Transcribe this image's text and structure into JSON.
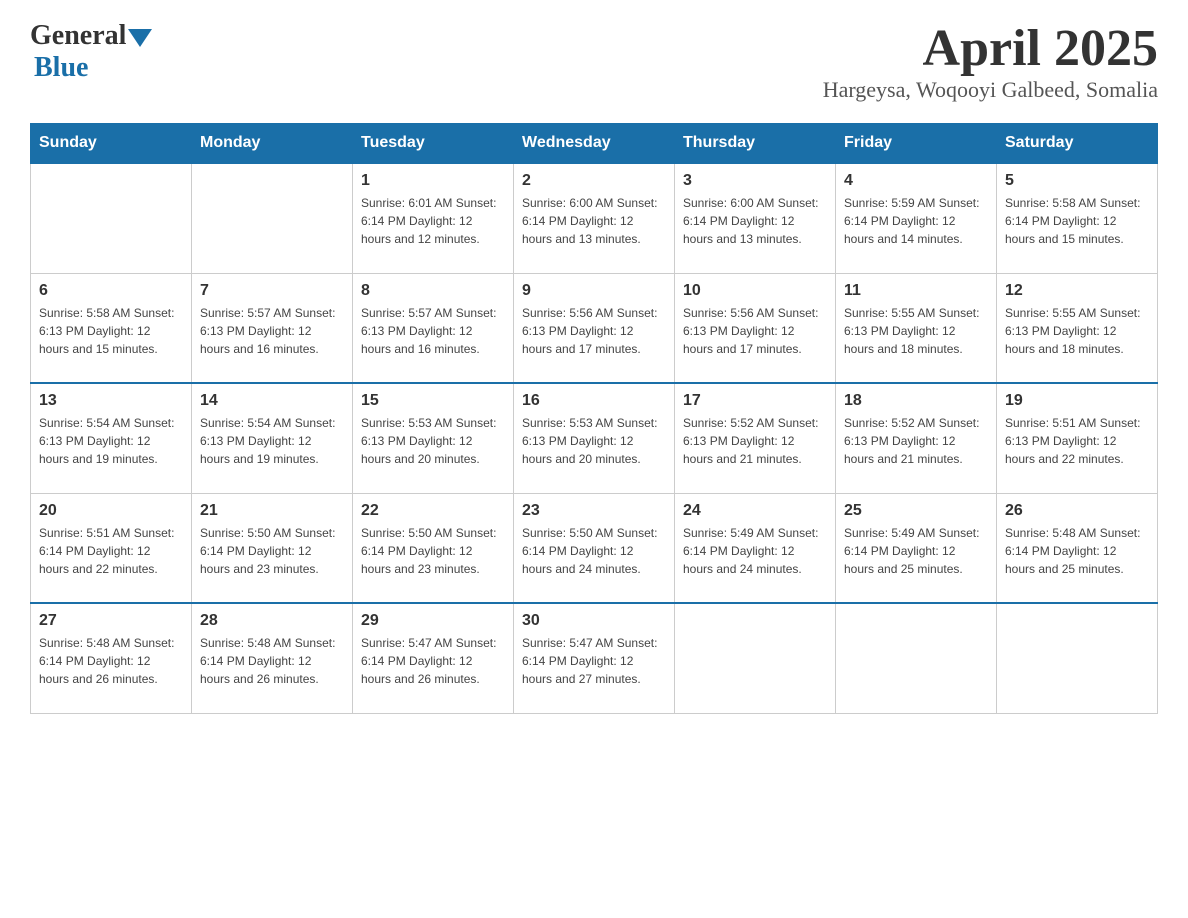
{
  "header": {
    "logo": {
      "general": "General",
      "blue": "Blue"
    },
    "title": "April 2025",
    "location": "Hargeysa, Woqooyi Galbeed, Somalia"
  },
  "days_of_week": [
    "Sunday",
    "Monday",
    "Tuesday",
    "Wednesday",
    "Thursday",
    "Friday",
    "Saturday"
  ],
  "weeks": [
    [
      {
        "day": "",
        "info": ""
      },
      {
        "day": "",
        "info": ""
      },
      {
        "day": "1",
        "info": "Sunrise: 6:01 AM\nSunset: 6:14 PM\nDaylight: 12 hours\nand 12 minutes."
      },
      {
        "day": "2",
        "info": "Sunrise: 6:00 AM\nSunset: 6:14 PM\nDaylight: 12 hours\nand 13 minutes."
      },
      {
        "day": "3",
        "info": "Sunrise: 6:00 AM\nSunset: 6:14 PM\nDaylight: 12 hours\nand 13 minutes."
      },
      {
        "day": "4",
        "info": "Sunrise: 5:59 AM\nSunset: 6:14 PM\nDaylight: 12 hours\nand 14 minutes."
      },
      {
        "day": "5",
        "info": "Sunrise: 5:58 AM\nSunset: 6:14 PM\nDaylight: 12 hours\nand 15 minutes."
      }
    ],
    [
      {
        "day": "6",
        "info": "Sunrise: 5:58 AM\nSunset: 6:13 PM\nDaylight: 12 hours\nand 15 minutes."
      },
      {
        "day": "7",
        "info": "Sunrise: 5:57 AM\nSunset: 6:13 PM\nDaylight: 12 hours\nand 16 minutes."
      },
      {
        "day": "8",
        "info": "Sunrise: 5:57 AM\nSunset: 6:13 PM\nDaylight: 12 hours\nand 16 minutes."
      },
      {
        "day": "9",
        "info": "Sunrise: 5:56 AM\nSunset: 6:13 PM\nDaylight: 12 hours\nand 17 minutes."
      },
      {
        "day": "10",
        "info": "Sunrise: 5:56 AM\nSunset: 6:13 PM\nDaylight: 12 hours\nand 17 minutes."
      },
      {
        "day": "11",
        "info": "Sunrise: 5:55 AM\nSunset: 6:13 PM\nDaylight: 12 hours\nand 18 minutes."
      },
      {
        "day": "12",
        "info": "Sunrise: 5:55 AM\nSunset: 6:13 PM\nDaylight: 12 hours\nand 18 minutes."
      }
    ],
    [
      {
        "day": "13",
        "info": "Sunrise: 5:54 AM\nSunset: 6:13 PM\nDaylight: 12 hours\nand 19 minutes."
      },
      {
        "day": "14",
        "info": "Sunrise: 5:54 AM\nSunset: 6:13 PM\nDaylight: 12 hours\nand 19 minutes."
      },
      {
        "day": "15",
        "info": "Sunrise: 5:53 AM\nSunset: 6:13 PM\nDaylight: 12 hours\nand 20 minutes."
      },
      {
        "day": "16",
        "info": "Sunrise: 5:53 AM\nSunset: 6:13 PM\nDaylight: 12 hours\nand 20 minutes."
      },
      {
        "day": "17",
        "info": "Sunrise: 5:52 AM\nSunset: 6:13 PM\nDaylight: 12 hours\nand 21 minutes."
      },
      {
        "day": "18",
        "info": "Sunrise: 5:52 AM\nSunset: 6:13 PM\nDaylight: 12 hours\nand 21 minutes."
      },
      {
        "day": "19",
        "info": "Sunrise: 5:51 AM\nSunset: 6:13 PM\nDaylight: 12 hours\nand 22 minutes."
      }
    ],
    [
      {
        "day": "20",
        "info": "Sunrise: 5:51 AM\nSunset: 6:14 PM\nDaylight: 12 hours\nand 22 minutes."
      },
      {
        "day": "21",
        "info": "Sunrise: 5:50 AM\nSunset: 6:14 PM\nDaylight: 12 hours\nand 23 minutes."
      },
      {
        "day": "22",
        "info": "Sunrise: 5:50 AM\nSunset: 6:14 PM\nDaylight: 12 hours\nand 23 minutes."
      },
      {
        "day": "23",
        "info": "Sunrise: 5:50 AM\nSunset: 6:14 PM\nDaylight: 12 hours\nand 24 minutes."
      },
      {
        "day": "24",
        "info": "Sunrise: 5:49 AM\nSunset: 6:14 PM\nDaylight: 12 hours\nand 24 minutes."
      },
      {
        "day": "25",
        "info": "Sunrise: 5:49 AM\nSunset: 6:14 PM\nDaylight: 12 hours\nand 25 minutes."
      },
      {
        "day": "26",
        "info": "Sunrise: 5:48 AM\nSunset: 6:14 PM\nDaylight: 12 hours\nand 25 minutes."
      }
    ],
    [
      {
        "day": "27",
        "info": "Sunrise: 5:48 AM\nSunset: 6:14 PM\nDaylight: 12 hours\nand 26 minutes."
      },
      {
        "day": "28",
        "info": "Sunrise: 5:48 AM\nSunset: 6:14 PM\nDaylight: 12 hours\nand 26 minutes."
      },
      {
        "day": "29",
        "info": "Sunrise: 5:47 AM\nSunset: 6:14 PM\nDaylight: 12 hours\nand 26 minutes."
      },
      {
        "day": "30",
        "info": "Sunrise: 5:47 AM\nSunset: 6:14 PM\nDaylight: 12 hours\nand 27 minutes."
      },
      {
        "day": "",
        "info": ""
      },
      {
        "day": "",
        "info": ""
      },
      {
        "day": "",
        "info": ""
      }
    ]
  ]
}
